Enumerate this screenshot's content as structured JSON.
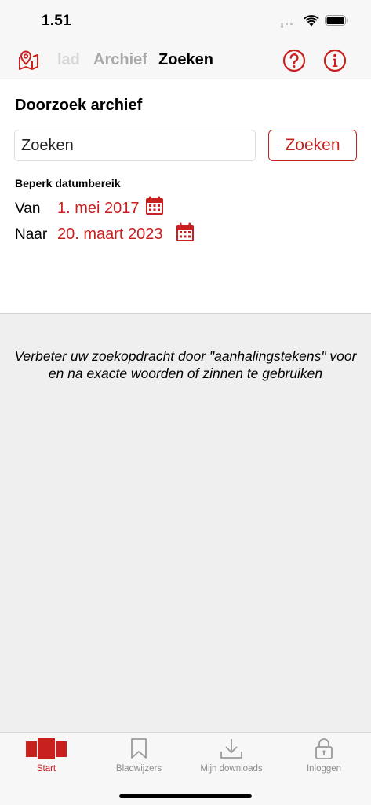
{
  "status_bar": {
    "time": "1.51"
  },
  "nav": {
    "tabs": [
      {
        "label": "Dagblad"
      },
      {
        "label": "Archief"
      },
      {
        "label": "Zoeken"
      }
    ],
    "visible_partial_tab": "lad"
  },
  "search": {
    "heading": "Doorzoek archief",
    "input_placeholder": "Zoeken",
    "button_label": "Zoeken",
    "range_title": "Beperk datumbereik",
    "from_label": "Van",
    "from_date": "1. mei 2017",
    "to_label": "Naar",
    "to_date": "20. maart 2023"
  },
  "hint": "Verbeter uw zoekopdracht door \"aanhalingstekens\" voor en na exacte woorden of zinnen te gebruiken",
  "tabbar": {
    "items": [
      {
        "label": "Start",
        "icon": "newspaper-icon",
        "active": true
      },
      {
        "label": "Bladwijzers",
        "icon": "bookmark-icon",
        "active": false
      },
      {
        "label": "Mijn downloads",
        "icon": "download-icon",
        "active": false
      },
      {
        "label": "Inloggen",
        "icon": "lock-icon",
        "active": false
      }
    ]
  },
  "colors": {
    "accent": "#c8201f",
    "inactive": "#8e8e8e",
    "background": "#efefef"
  }
}
